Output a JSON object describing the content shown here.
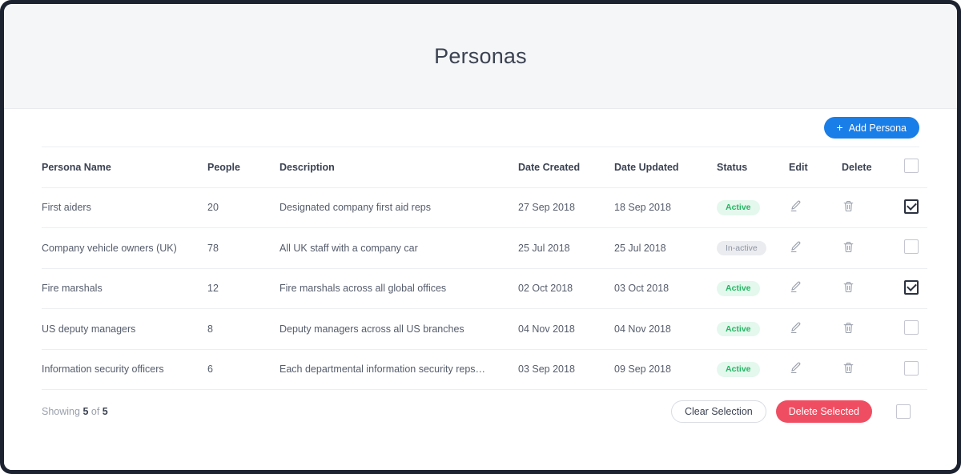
{
  "header": {
    "title": "Personas"
  },
  "toolbar": {
    "add_label": "Add Persona",
    "add_icon": "plus-icon",
    "plus_glyph": "+"
  },
  "table": {
    "columns": [
      {
        "key": "name",
        "label": "Persona Name"
      },
      {
        "key": "people",
        "label": "People"
      },
      {
        "key": "desc",
        "label": "Description"
      },
      {
        "key": "created",
        "label": "Date Created"
      },
      {
        "key": "updated",
        "label": "Date Updated"
      },
      {
        "key": "status",
        "label": "Status"
      },
      {
        "key": "edit",
        "label": "Edit"
      },
      {
        "key": "delete",
        "label": "Delete"
      }
    ],
    "header_select_all_checked": false,
    "rows": [
      {
        "name": "First aiders",
        "people": "20",
        "desc": "Designated company first aid reps",
        "created": "27 Sep 2018",
        "updated": "18 Sep 2018",
        "status": "Active",
        "status_kind": "active",
        "checked": true
      },
      {
        "name": "Company vehicle owners (UK)",
        "people": "78",
        "desc": "All UK staff with a company car",
        "created": "25 Jul 2018",
        "updated": "25 Jul 2018",
        "status": "In-active",
        "status_kind": "inactive",
        "checked": false
      },
      {
        "name": "Fire marshals",
        "people": "12",
        "desc": "Fire marshals across all global offices",
        "created": "02 Oct 2018",
        "updated": "03 Oct 2018",
        "status": "Active",
        "status_kind": "active",
        "checked": true
      },
      {
        "name": "US deputy managers",
        "people": "8",
        "desc": "Deputy managers across all US branches",
        "created": "04 Nov 2018",
        "updated": "04 Nov 2018",
        "status": "Active",
        "status_kind": "active",
        "checked": false
      },
      {
        "name": "Information security officers",
        "people": "6",
        "desc": "Each departmental information security reps…",
        "created": "03 Sep 2018",
        "updated": "09 Sep 2018",
        "status": "Active",
        "status_kind": "active",
        "checked": false
      }
    ],
    "row_icons": {
      "edit": "pencil-icon",
      "delete": "trash-icon"
    }
  },
  "footer": {
    "showing_prefix": "Showing",
    "showing_count": "5",
    "showing_middle": "of",
    "showing_total": "5",
    "clear_label": "Clear Selection",
    "delete_label": "Delete Selected",
    "footer_select_all_checked": false
  },
  "colors": {
    "accent_blue": "#1a7ee8",
    "danger_red": "#ef4e62",
    "status_active_text": "#24b663",
    "status_active_bg": "#e4f8ed",
    "status_inactive_text": "#8d94a3",
    "status_inactive_bg": "#ebecef",
    "header_band": "#f5f6f8",
    "frame": "#1c2230"
  }
}
